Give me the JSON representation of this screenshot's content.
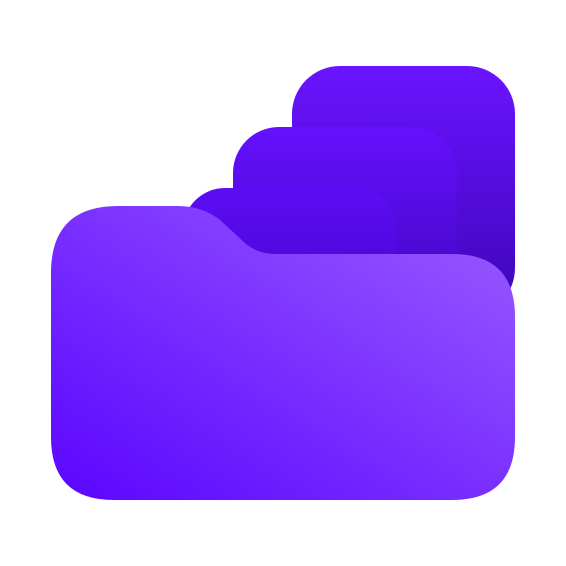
{
  "app_icon": {
    "name": "folder-stack-icon",
    "colors": {
      "background": "#ffffff",
      "back_sheet_light": "#6a14ff",
      "back_sheet_dark": "#3d05b8",
      "middle_sheet_light": "#6610ff",
      "middle_sheet_dark": "#3e06bd",
      "front_sheet_light": "#5d0cf6",
      "front_sheet_dark": "#4207c9",
      "folder_top_right": "#9a5cff",
      "folder_bottom_left": "#5a05ff"
    }
  }
}
